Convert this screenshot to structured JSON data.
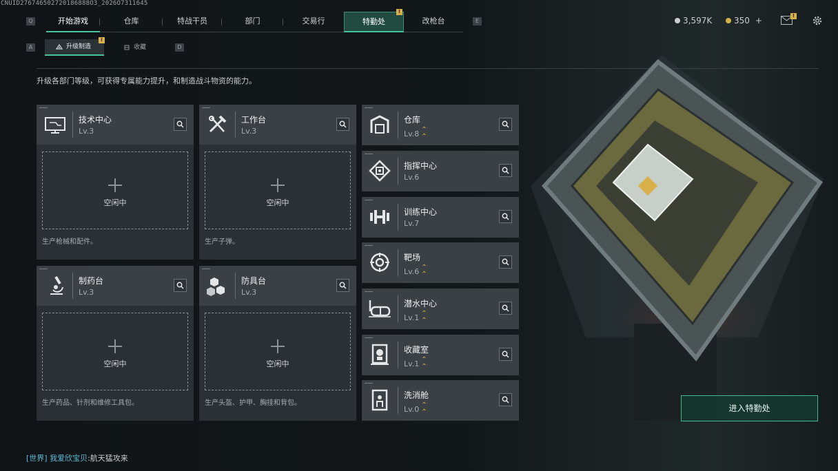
{
  "uid": "CNUID276746502720186888O3_2026O7311645",
  "hotkeys": {
    "prev_tab": "Q",
    "next_tab": "E",
    "prev_sub": "A",
    "next_sub": "D"
  },
  "tabs": [
    {
      "label": "开始游戏"
    },
    {
      "label": "仓库"
    },
    {
      "label": "特战干员"
    },
    {
      "label": "部门"
    },
    {
      "label": "交易行"
    },
    {
      "label": "特勤处",
      "active": true,
      "badge": "!"
    },
    {
      "label": "改枪台"
    }
  ],
  "subtabs": [
    {
      "label": "升级制造",
      "active": true,
      "badge": "!"
    },
    {
      "label": "收藏"
    }
  ],
  "currency": {
    "coins": "3,597K",
    "tickets": "350",
    "add": "+"
  },
  "mail_badge": "!",
  "description": "升级各部门等级，可获得专属能力提升，和制造战斗物资的能力。",
  "idle_label": "空闲中",
  "modules": [
    {
      "name": "技术中心",
      "level": "Lv.3",
      "product": "生产枪械和配件。",
      "icon": "computer-icon"
    },
    {
      "name": "工作台",
      "level": "Lv.3",
      "product": "生产子弹。",
      "icon": "tools-icon"
    },
    {
      "name": "制药台",
      "level": "Lv.3",
      "product": "生产药品、针剂和维修工具包。",
      "icon": "microscope-icon"
    },
    {
      "name": "防具台",
      "level": "Lv.3",
      "product": "生产头盔、护甲、胸挂和背包。",
      "icon": "cubes-icon"
    }
  ],
  "facilities": [
    {
      "name": "仓库",
      "level": "Lv.8",
      "upgrade": true,
      "icon": "warehouse-icon"
    },
    {
      "name": "指挥中心",
      "level": "Lv.6",
      "upgrade": false,
      "icon": "chip-icon"
    },
    {
      "name": "训练中心",
      "level": "Lv.7",
      "upgrade": false,
      "icon": "dumbbell-icon"
    },
    {
      "name": "靶场",
      "level": "Lv.6",
      "upgrade": true,
      "icon": "target-icon"
    },
    {
      "name": "潜水中心",
      "level": "Lv.1",
      "upgrade": true,
      "icon": "diving-mask-icon"
    },
    {
      "name": "收藏室",
      "level": "Lv.1",
      "upgrade": true,
      "icon": "trophy-icon"
    },
    {
      "name": "洗消舱",
      "level": "Lv.0",
      "upgrade": true,
      "icon": "decon-icon"
    }
  ],
  "enter_button": "进入特勤处",
  "chat": {
    "channel": "[世界]",
    "nick": "我爱欣宝贝",
    "message": ":航天猛攻来"
  },
  "colors": {
    "accent": "#46c79b",
    "badge": "#d8b04a",
    "upgrade": "#e0b34a",
    "chat": "#5fb8d6"
  }
}
